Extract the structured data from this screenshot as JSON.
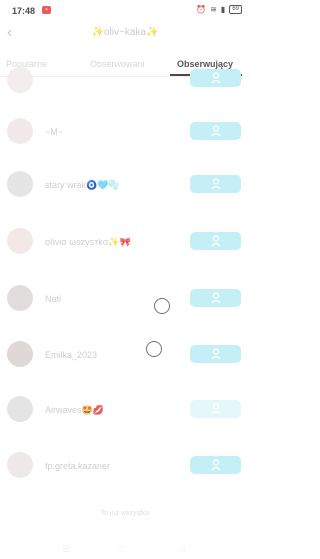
{
  "status_bar": {
    "time": "17:48",
    "battery": "69"
  },
  "header": {
    "title": "✨oliv~kaka✨",
    "back_icon": "back-arrow-icon"
  },
  "tabs": [
    {
      "label": "Popularne",
      "active": false
    },
    {
      "label": "Obserwowani",
      "active": false
    },
    {
      "label": "Obserwujący",
      "active": true
    }
  ],
  "followers": [
    {
      "name": ""
    },
    {
      "name": "~M~"
    },
    {
      "name": "stary wrak🧿🩵🫧"
    },
    {
      "name": "oℓινια ωѕzуѕтkσ✨🎀"
    },
    {
      "name": "Nati"
    },
    {
      "name": "Emilka_2023"
    },
    {
      "name": "Airwaves🤩💋"
    },
    {
      "name": "fp.greta.kazaner"
    }
  ],
  "footer_note": "To już wszystko",
  "colors": {
    "follow_button": "#b8ecf4",
    "active_tab_underline": "#222222"
  }
}
